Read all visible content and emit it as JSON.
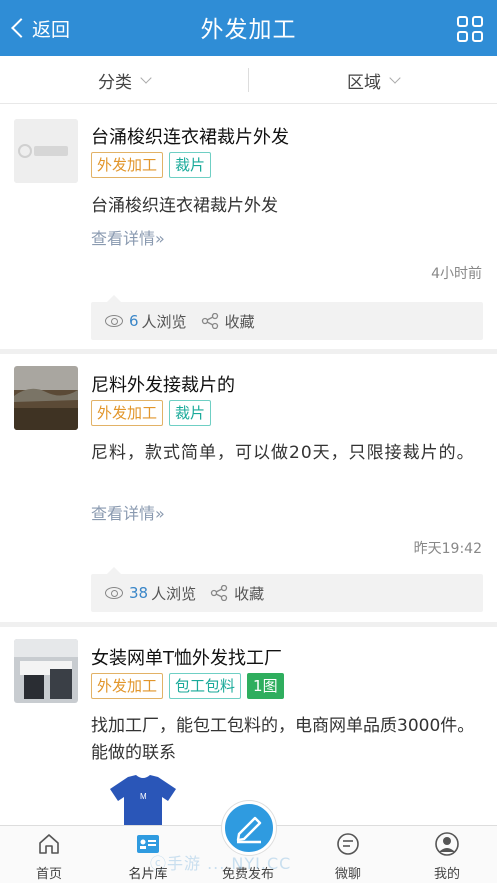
{
  "header": {
    "back_label": "返回",
    "title": "外发加工"
  },
  "filters": {
    "category": "分类",
    "region": "区域"
  },
  "posts": [
    {
      "title": "台涌梭织连衣裙裁片外发",
      "tags": [
        "外发加工",
        "裁片"
      ],
      "description": "台涌梭织连衣裙裁片外发",
      "more": "查看详情»",
      "time": "4小时前",
      "views": "6",
      "views_suffix": "人浏览",
      "favorite": "收藏"
    },
    {
      "title": "尼料外发接裁片的",
      "tags": [
        "外发加工",
        "裁片"
      ],
      "description": "尼料，款式简单，可以做20天，只限接裁片的。",
      "more": "查看详情»",
      "time": "昨天19:42",
      "views": "38",
      "views_suffix": "人浏览",
      "favorite": "收藏"
    },
    {
      "title": "女装网单T恤外发找工厂",
      "tags": [
        "外发加工",
        "包工包料",
        "1图"
      ],
      "description": "找加工厂，能包工包料的，电商网单品质3000件。能做的联系"
    }
  ],
  "tabbar": {
    "items": [
      {
        "label": "首页",
        "icon": "home-icon"
      },
      {
        "label": "名片库",
        "icon": "card-icon"
      },
      {
        "label": "免费发布",
        "icon": "publish-icon"
      },
      {
        "label": "微聊",
        "icon": "chat-icon"
      },
      {
        "label": "我的",
        "icon": "profile-icon"
      }
    ]
  },
  "watermark": "ⓒ手游 ... NYI.CC",
  "colors": {
    "accent": "#2f8dd6",
    "tag_orange": "#e2962b",
    "tag_teal": "#1aaa9a",
    "tag_green": "#2fae5e",
    "link": "#8a9ab0"
  }
}
